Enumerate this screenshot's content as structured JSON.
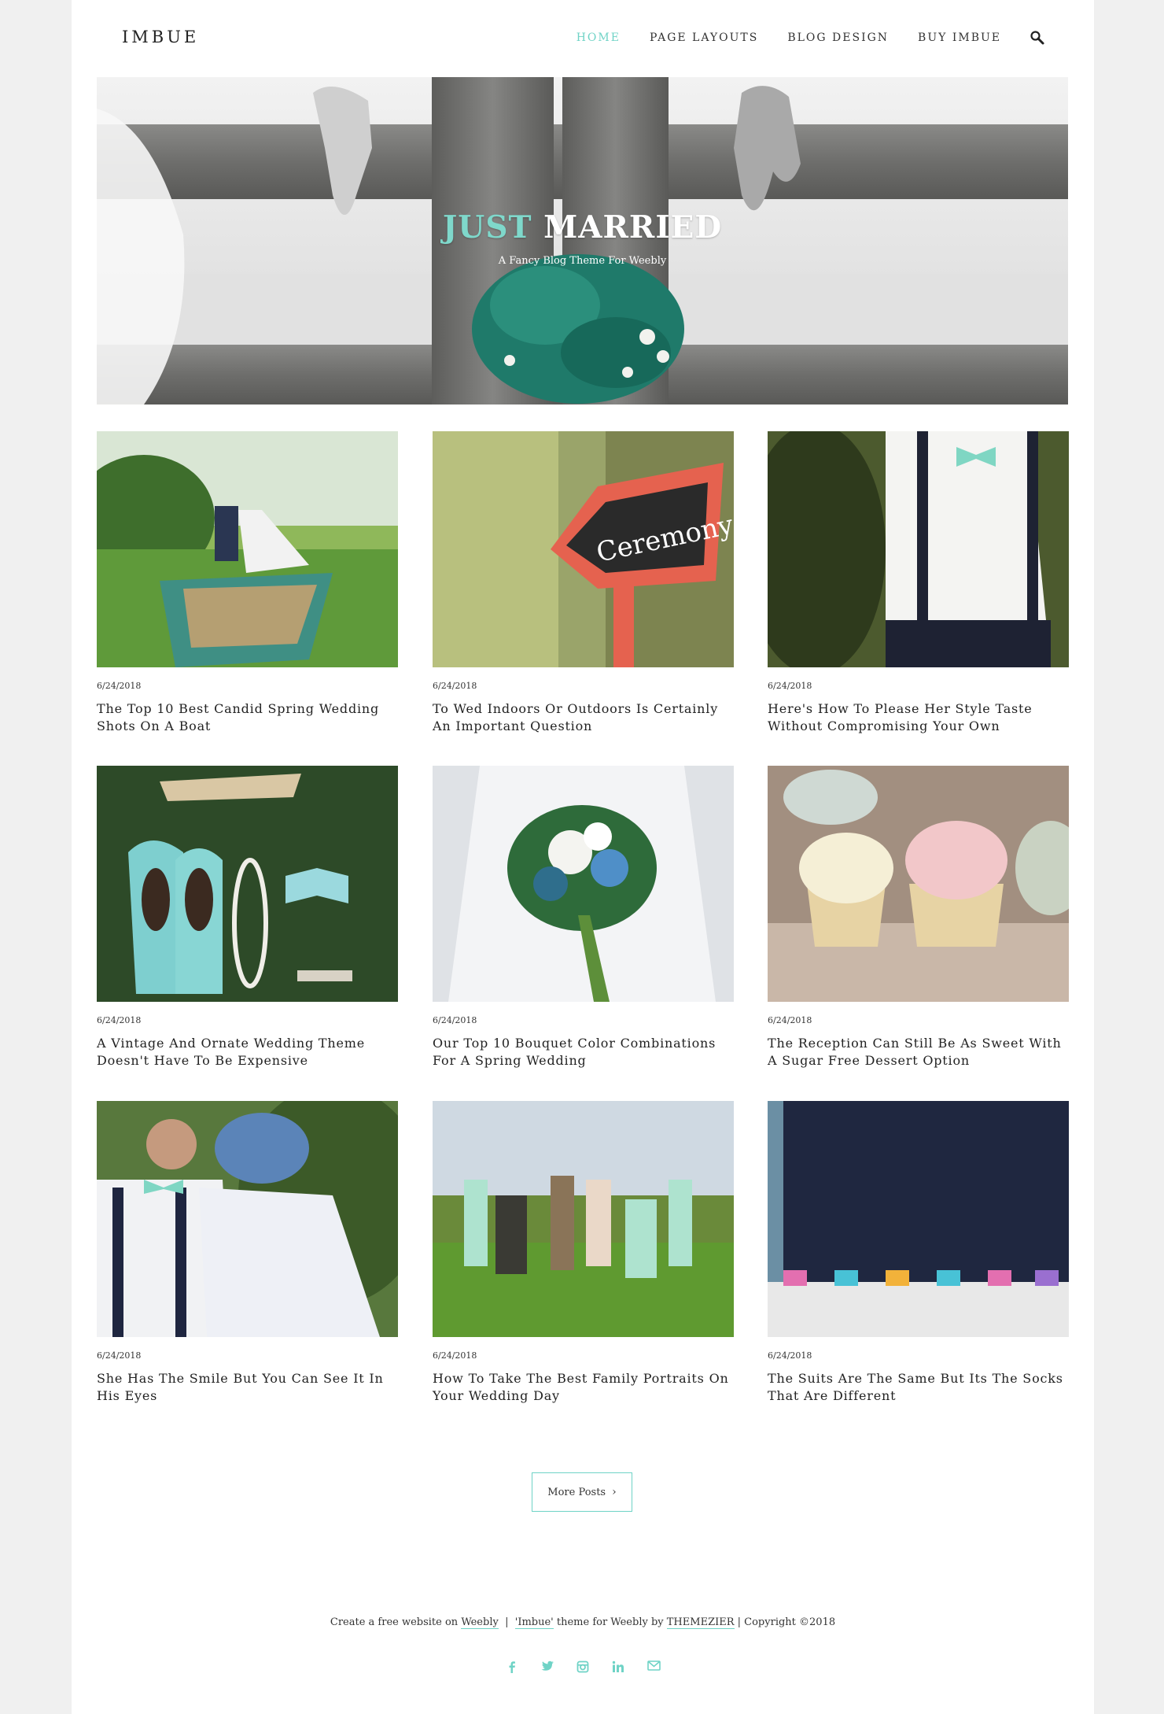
{
  "header": {
    "logo": "IMBUE",
    "nav": [
      {
        "label": "HOME",
        "active": true
      },
      {
        "label": "PAGE LAYOUTS",
        "active": false
      },
      {
        "label": "BLOG DESIGN",
        "active": false
      },
      {
        "label": "BUY IMBUE",
        "active": false
      }
    ],
    "search_icon": "search-icon"
  },
  "hero": {
    "title_accent": "JUST",
    "title_rest": "MARRIED",
    "subtitle": "A Fancy Blog Theme For Weebly"
  },
  "posts": [
    {
      "date": "6/24/2018",
      "title": "The Top 10 Best Candid Spring Wedding Shots On A Boat"
    },
    {
      "date": "6/24/2018",
      "title": "To Wed Indoors Or Outdoors Is Certainly An Important Question"
    },
    {
      "date": "6/24/2018",
      "title": "Here's How To Please Her Style Taste Without Compromising Your Own"
    },
    {
      "date": "6/24/2018",
      "title": "A Vintage And Ornate Wedding Theme Doesn't Have To Be Expensive"
    },
    {
      "date": "6/24/2018",
      "title": "Our Top 10 Bouquet Color Combinations For A Spring Wedding"
    },
    {
      "date": "6/24/2018",
      "title": "The Reception Can Still Be As Sweet With A Sugar Free Dessert Option"
    },
    {
      "date": "6/24/2018",
      "title": "She Has The Smile But You Can See It In His Eyes"
    },
    {
      "date": "6/24/2018",
      "title": "How To Take The Best Family Portraits On Your Wedding Day"
    },
    {
      "date": "6/24/2018",
      "title": "The Suits Are The Same But Its The Socks That Are Different"
    }
  ],
  "more_posts": "More Posts",
  "footer": {
    "prefix": "Create a free website on ",
    "weebly": "Weebly",
    "sep": "  |  ",
    "theme": "'Imbue'",
    "mid": " theme for Weebly by ",
    "themezier": "THEMEZIER",
    "copyright": " | Copyright ©2018",
    "social": [
      "facebook-icon",
      "twitter-icon",
      "instagram-icon",
      "linkedin-icon",
      "mail-icon"
    ]
  },
  "colors": {
    "accent": "#6fd3c6",
    "text": "#333333",
    "background": "#f0f0f0"
  }
}
